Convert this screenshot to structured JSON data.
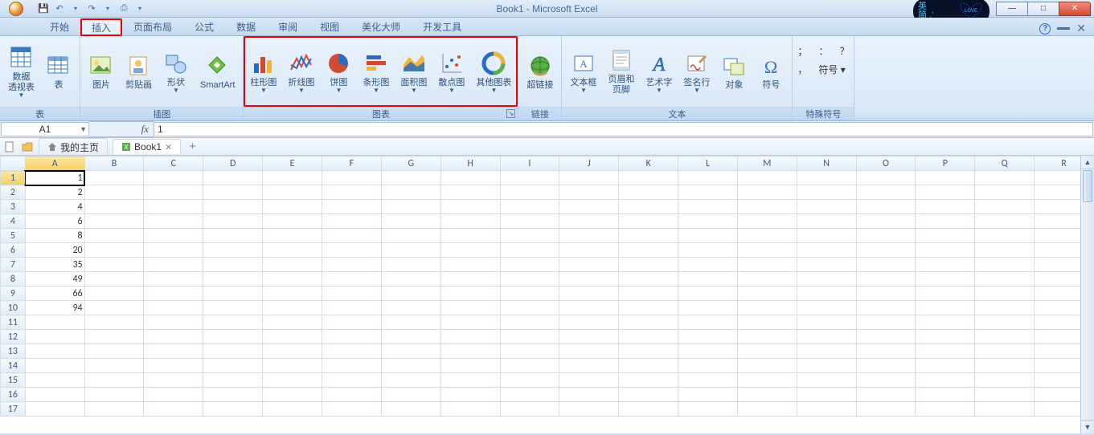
{
  "title": "Book1 - Microsoft Excel",
  "widget": {
    "line1": "英",
    "line2": "简",
    "dots": ",'",
    "heart": "LOVE"
  },
  "win": {
    "min": "—",
    "max": "□",
    "close": "✕"
  },
  "qat": {
    "save": "💾",
    "undo": "↶",
    "redo": "↷",
    "print": "⎙",
    "custom": "▾"
  },
  "tabs": {
    "home": "开始",
    "insert": "插入",
    "layout": "页面布局",
    "formula": "公式",
    "data": "数据",
    "review": "审阅",
    "view": "视图",
    "beautify": "美化大师",
    "devtools": "开发工具"
  },
  "tabs_right": {
    "help": "?",
    "min": "—",
    "close": "✕"
  },
  "ribbon": {
    "tables": {
      "label": "表",
      "pivot": "数据\n透视表",
      "table": "表"
    },
    "illustrations": {
      "label": "插图",
      "picture": "图片",
      "clipart": "剪贴画",
      "shapes": "形状",
      "smartart": "SmartArt"
    },
    "charts": {
      "label": "图表",
      "column": "柱形图",
      "line": "折线图",
      "pie": "饼图",
      "bar": "条形图",
      "area": "面积图",
      "scatter": "散点图",
      "other": "其他图表"
    },
    "links": {
      "label": "链接",
      "hyperlink": "超链接"
    },
    "text": {
      "label": "文本",
      "textbox": "文本框",
      "headerfooter": "页眉和\n页脚",
      "wordart": "艺术字",
      "signature": "签名行",
      "object": "对象",
      "symbol": "符号"
    },
    "special": {
      "label": "特殊符号",
      "semi": "；",
      "colon": "：",
      "question": "？",
      "comma": "，",
      "sym": "符号"
    }
  },
  "namebox": "A1",
  "formula": "1",
  "fxlabel": "fx",
  "sheetbar": {
    "home": "我的主页",
    "book": "Book1"
  },
  "columns": [
    "A",
    "B",
    "C",
    "D",
    "E",
    "F",
    "G",
    "H",
    "I",
    "J",
    "K",
    "L",
    "M",
    "N",
    "O",
    "P",
    "Q",
    "R"
  ],
  "rows": [
    "1",
    "2",
    "3",
    "4",
    "5",
    "6",
    "7",
    "8",
    "9",
    "10",
    "11",
    "12",
    "13",
    "14",
    "15",
    "16",
    "17"
  ],
  "data_col_a": {
    "1": "1",
    "2": "2",
    "3": "4",
    "4": "6",
    "5": "8",
    "6": "20",
    "7": "35",
    "8": "49",
    "9": "66",
    "10": "94"
  },
  "selected_cell": "A1"
}
